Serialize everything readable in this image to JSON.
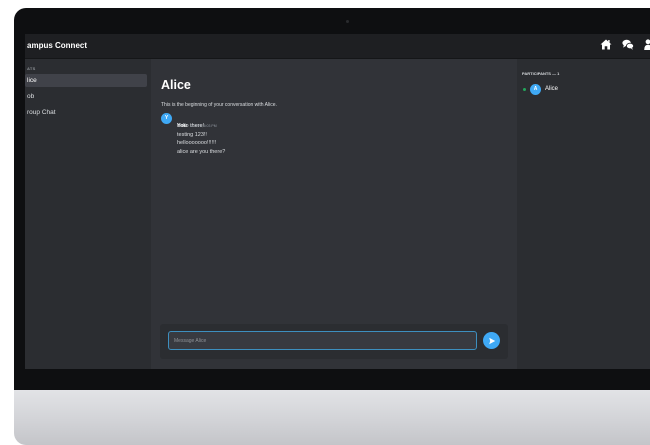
{
  "app": {
    "title": "ampus Connect"
  },
  "sidebar": {
    "section_label": "ATS",
    "channels": [
      {
        "label": "lice",
        "active": true
      },
      {
        "label": "ob",
        "active": false
      },
      {
        "label": "roup Chat",
        "active": false
      }
    ]
  },
  "conversation": {
    "title": "Alice",
    "intro": "This is the beginning of your conversation with Alice.",
    "messages": [
      {
        "author": "You",
        "avatar_letter": "Y",
        "timestamp": "4/29/25, 6:03 PM",
        "lines": [
          "hello there!",
          "testing 123!!",
          "hellooooooo!!!!!!",
          "alice are you there?"
        ]
      }
    ]
  },
  "composer": {
    "placeholder": "Message Alice"
  },
  "participants": {
    "label": "PARTICIPANTS — 1",
    "members": [
      {
        "name": "Alice",
        "avatar_letter": "A",
        "status": "online"
      }
    ]
  },
  "icons": {
    "top": [
      "home-icon",
      "chat-bubbles-icon",
      "user-icon"
    ],
    "send": "send-arrow-icon"
  },
  "colors": {
    "accent": "#3fa9f5",
    "online": "#23a55a",
    "active_channel": "#404249"
  }
}
